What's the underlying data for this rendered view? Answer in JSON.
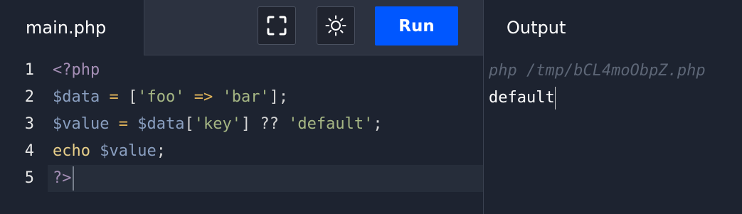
{
  "header": {
    "file_name": "main.php",
    "run_label": "Run",
    "output_title": "Output"
  },
  "toolbar": {
    "fullscreen_icon": "fullscreen-icon",
    "theme_icon": "sun-icon"
  },
  "editor": {
    "line_numbers": [
      "1",
      "2",
      "3",
      "4",
      "5"
    ],
    "lines": {
      "l1": {
        "open_tag": "<?php"
      },
      "l2": {
        "var": "$data",
        "eq": " = ",
        "lbr": "[",
        "s1": "'foo'",
        "arrow": " => ",
        "s2": "'bar'",
        "rbr": "];"
      },
      "l3": {
        "var": "$value",
        "eq": " = ",
        "var2": "$data",
        "lbr": "[",
        "s1": "'key'",
        "rbr": "]",
        "coal": " ?? ",
        "s2": "'default'",
        "semi": ";"
      },
      "l4": {
        "kw": "echo",
        "sp": " ",
        "var": "$value",
        "semi": ";"
      },
      "l5": {
        "close_tag": "?>"
      }
    }
  },
  "output": {
    "command": "php /tmp/bCL4moObpZ.php",
    "text": "default"
  },
  "colors": {
    "background": "#1d2330",
    "toolbar": "#2c3240",
    "run_button": "#0057ff"
  }
}
